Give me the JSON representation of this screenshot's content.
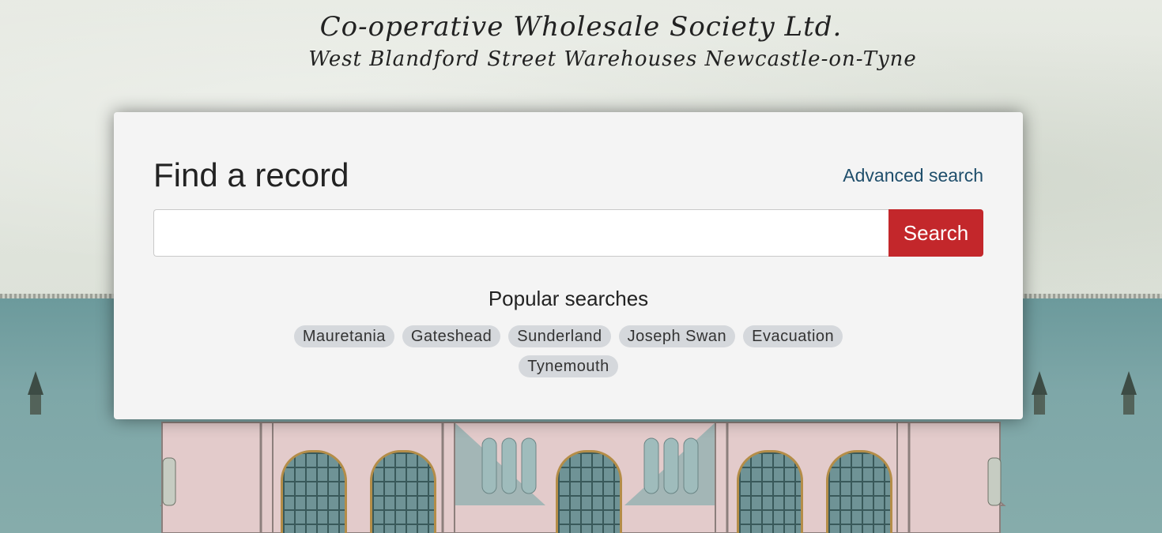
{
  "background": {
    "heading_line1": "Co-operative Wholesale Society Ltd.",
    "heading_line2": "West Blandford Street Warehouses Newcastle-on-Tyne"
  },
  "search_panel": {
    "title": "Find a record",
    "advanced_link": "Advanced search",
    "input_value": "",
    "input_placeholder": "",
    "button_label": "Search",
    "popular_title": "Popular searches",
    "popular_tags": [
      "Mauretania",
      "Gateshead",
      "Sunderland",
      "Joseph Swan",
      "Evacuation",
      "Tynemouth"
    ]
  },
  "colors": {
    "search_button": "#c3272b",
    "link": "#1f4e6b",
    "tag_background": "#d5d8dc",
    "panel_background": "#f4f4f4"
  }
}
